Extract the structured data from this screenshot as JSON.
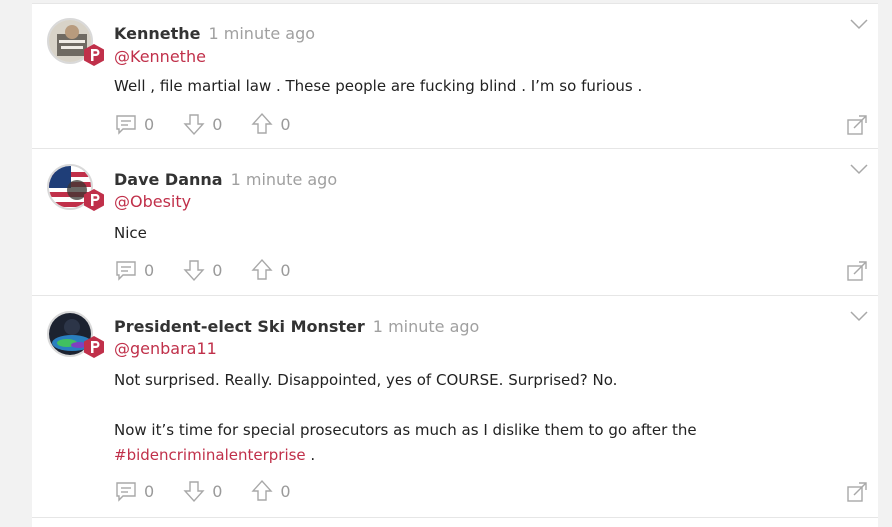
{
  "posts": [
    {
      "name": "Kennethe",
      "time": "1 minute ago",
      "handle": "@Kennethe",
      "lines": [
        "Well , file martial law . These people are fucking blind . I’m so furious ."
      ],
      "comments": "0",
      "downvotes": "0",
      "upvotes": "0"
    },
    {
      "name": "Dave Danna",
      "time": "1 minute ago",
      "handle": "@Obesity",
      "lines": [
        "Nice"
      ],
      "comments": "0",
      "downvotes": "0",
      "upvotes": "0"
    },
    {
      "name": "President-elect Ski Monster",
      "time": "1 minute ago",
      "handle": "@genbara11",
      "lines": [
        "Not surprised. Really. Disappointed, yes of COURSE. Surprised? No.",
        "Now it’s time for special prosecutors as much as I dislike them to go after the"
      ],
      "hashtag": "#bidencriminalenterprise",
      "hashtag_suffix": " .",
      "comments": "0",
      "downvotes": "0",
      "upvotes": "0"
    }
  ],
  "colors": {
    "brand": "#c0304a",
    "muted": "#9a9a9a"
  },
  "icons": {
    "badge": "parler-p-icon",
    "comment": "comment-icon",
    "downvote": "downvote-arrow-icon",
    "upvote": "upvote-arrow-icon",
    "menu": "chevron-down-icon",
    "share": "share-icon"
  }
}
